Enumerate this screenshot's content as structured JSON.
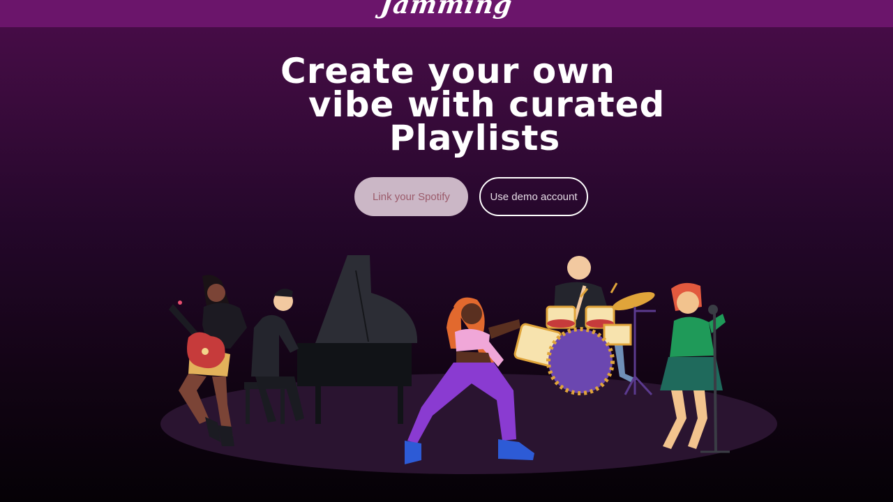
{
  "header": {
    "logo_text": "Jamming"
  },
  "hero": {
    "headline_line1": "Create your own",
    "headline_line2": "vibe with curated",
    "headline_line3": "Playlists"
  },
  "actions": {
    "link_spotify_label": "Link your Spotify",
    "demo_account_label": "Use demo account"
  },
  "illustration": {
    "characters": [
      "guitarist",
      "pianist",
      "dancer",
      "drummer",
      "singer"
    ],
    "colors": {
      "stage": "#2a1430",
      "piano": "#2c2d35",
      "drum_purple": "#6b47b0",
      "cymbal": "#e0a43a",
      "dress_green": "#1f6a5c"
    }
  }
}
